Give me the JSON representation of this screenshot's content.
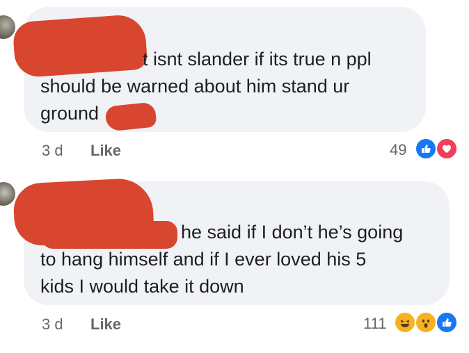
{
  "comments": [
    {
      "text_line1": "t isnt slander if its true n ppl",
      "text_line2": "should be warned about him stand ur",
      "text_line3": "ground",
      "time": "3 d",
      "like_label": "Like",
      "reaction_count": "49",
      "reactions": [
        "like-icon",
        "love-icon"
      ]
    },
    {
      "text_line1": "he said if I don’t he’s going",
      "text_line2": "to hang himself and if I ever loved his 5",
      "text_line3": "kids I would take it down",
      "time": "3 d",
      "like_label": "Like",
      "reaction_count": "111",
      "reactions": [
        "haha-icon",
        "wow-icon",
        "like-icon"
      ]
    }
  ],
  "colors": {
    "bubble": "#f0f2f5",
    "redaction": "#d8462f",
    "like_blue": "#1877f2",
    "love_red": "#f33e58",
    "emoji_yellow": "#f7b125"
  }
}
